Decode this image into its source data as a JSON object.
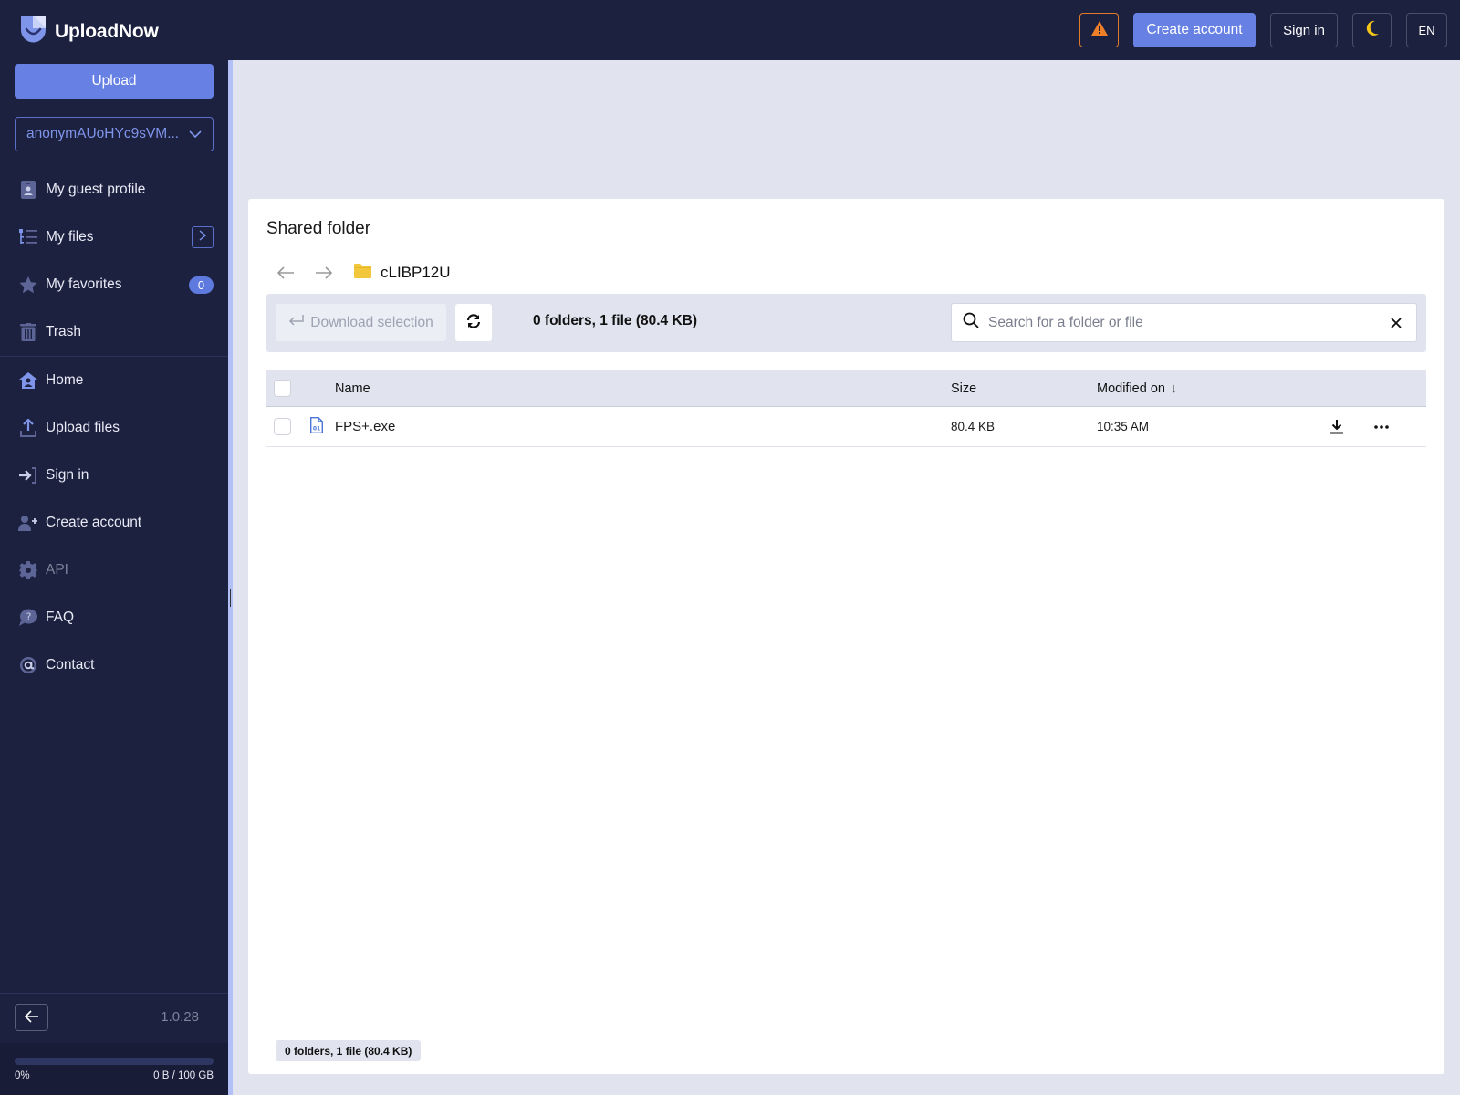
{
  "app": {
    "name": "UploadNow",
    "accent": "#6680e4",
    "sidebar_bg": "#1c2140"
  },
  "topbar": {
    "warning_icon": "warning-triangle-icon",
    "create_account": "Create account",
    "sign_in": "Sign in",
    "theme_icon": "moon-icon",
    "language": "EN"
  },
  "sidebar": {
    "upload_label": "Upload",
    "account_name": "anonymAUoHYc9sVM...",
    "items_top": [
      {
        "label": "My guest profile",
        "icon": "id-badge-icon"
      },
      {
        "label": "My files",
        "icon": "file-tree-icon"
      },
      {
        "label": "My favorites",
        "icon": "star-icon",
        "badge": "0"
      },
      {
        "label": "Trash",
        "icon": "trash-icon"
      }
    ],
    "items_bottom": [
      {
        "label": "Home",
        "icon": "home-icon"
      },
      {
        "label": "Upload files",
        "icon": "upload-icon"
      },
      {
        "label": "Sign in",
        "icon": "sign-in-icon"
      },
      {
        "label": "Create account",
        "icon": "user-plus-icon"
      },
      {
        "label": "API",
        "icon": "gear-icon"
      },
      {
        "label": "FAQ",
        "icon": "question-bubble-icon"
      },
      {
        "label": "Contact",
        "icon": "at-sign-icon"
      }
    ],
    "version": "1.0.28",
    "quota": {
      "percent_label": "0%",
      "used_label": "0 B / 100 GB",
      "fraction": 0
    }
  },
  "main": {
    "title": "Shared folder",
    "folder_name": "cLIBP12U",
    "toolbar": {
      "download_selection": "Download selection",
      "summary": "0 folders, 1 file (80.4 KB)",
      "search_placeholder": "Search for a folder or file",
      "search_value": ""
    },
    "table": {
      "columns": {
        "name": "Name",
        "size": "Size",
        "modified": "Modified on"
      },
      "sort_indicator": "↓",
      "rows": [
        {
          "name": "FPS+.exe",
          "size": "80.4 KB",
          "modified": "10:35 AM",
          "icon": "binary-file-icon"
        }
      ]
    },
    "footer_summary": "0 folders, 1 file (80.4 KB)"
  }
}
